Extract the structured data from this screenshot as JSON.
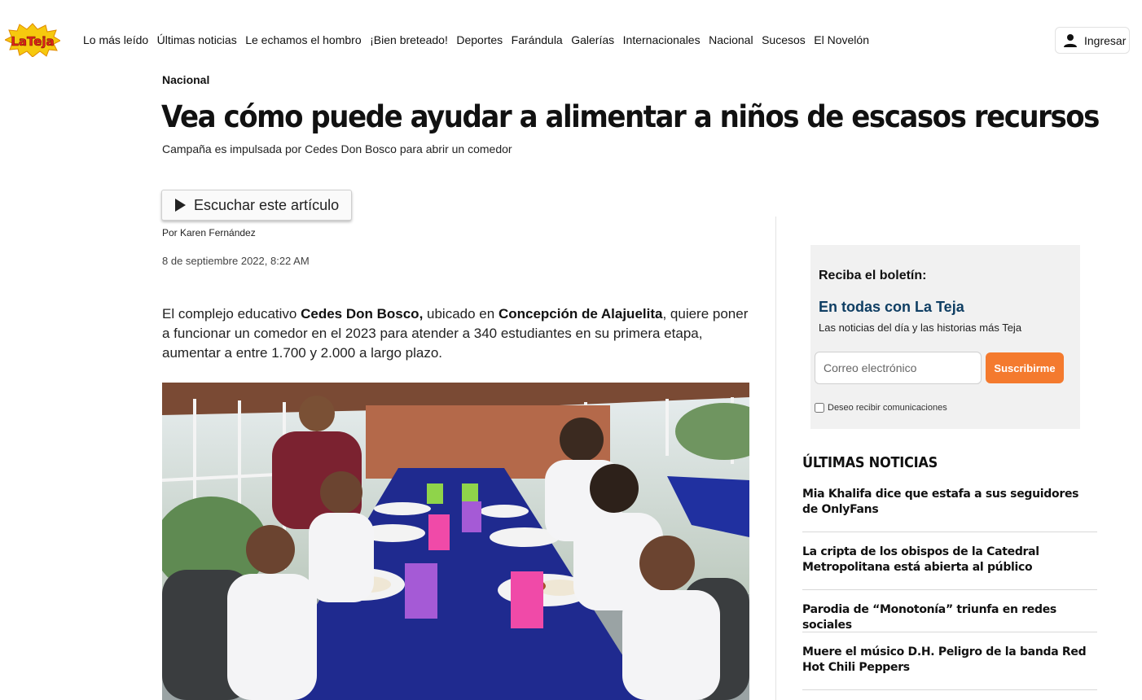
{
  "nav": {
    "logo_text": "LaTeja",
    "links": [
      "Lo más leído",
      "Últimas noticias",
      "Le echamos el hombro",
      "¡Bien breteado!",
      "Deportes",
      "Farándula",
      "Galerías",
      "Internacionales",
      "Nacional",
      "Sucesos",
      "El Novelón"
    ],
    "login_label": "Ingresar"
  },
  "article": {
    "section": "Nacional",
    "headline": "Vea cómo puede ayudar a alimentar a niños de escasos recursos",
    "subhead": "Campaña es impulsada por Cedes Don Bosco para abrir un comedor",
    "listen_label": "Escuchar este artículo",
    "byline": "Por Karen Fernández",
    "date": "8 de septiembre 2022, 8:22 AM",
    "body": {
      "p1_a": "El complejo educativo ",
      "p1_b": "Cedes Don Bosco,",
      "p1_c": " ubicado en ",
      "p1_d": "Concepción de Alajuelita",
      "p1_e": ", quiere poner a funcionar un comedor en el 2023 para atender a 340 estudiantes en su primera etapa, aumentar a entre 1.700 y 2.000 a largo plazo."
    }
  },
  "newsletter": {
    "title": "Reciba el boletín:",
    "brand": "En todas con La Teja",
    "description": "Las noticias del día y las historias más Teja",
    "email_placeholder": "Correo electrónico",
    "subscribe_label": "Suscribirme",
    "consent_label": "Deseo recibir comunicaciones"
  },
  "latest": {
    "title": "ÚLTIMAS NOTICIAS",
    "items": [
      "Mia Khalifa dice que estafa a sus seguidores de OnlyFans",
      "La cripta de los obispos de la Catedral Metropolitana está abierta al público",
      "Parodia de “Monotonía” triunfa en redes sociales",
      "Muere el músico D.H. Peligro de la banda Red Hot Chili Peppers"
    ]
  },
  "colors": {
    "accent_orange": "#f47a2e",
    "brand_blue": "#0f3e63",
    "tablecloth_blue": "#1f2a8f"
  }
}
